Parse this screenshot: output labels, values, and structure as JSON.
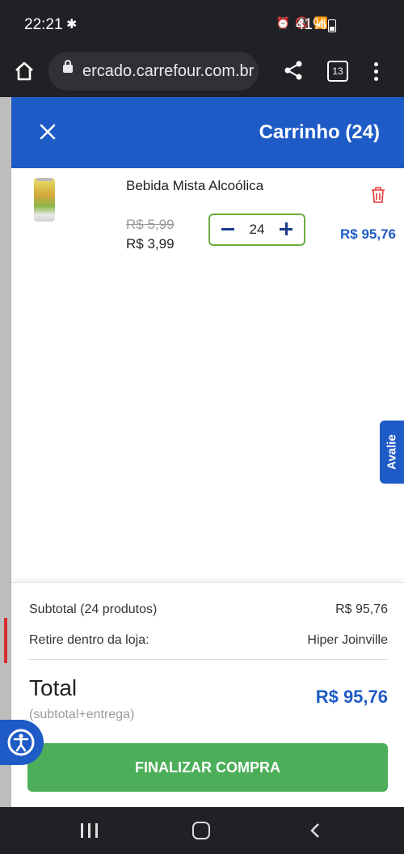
{
  "status_bar": {
    "time": "22:21",
    "battery": "41%",
    "network": "Vo) LTE1 4G"
  },
  "browser": {
    "url": "ercado.carrefour.com.br",
    "tab_count": "13"
  },
  "cart": {
    "title": "Carrinho (24)",
    "item": {
      "name": "Bebida Mista Alcoólica",
      "old_price": "R$ 5,99",
      "price": "R$ 3,99",
      "quantity": "24",
      "line_total": "R$ 95,76"
    }
  },
  "feedback_tab": {
    "label": "Avalie"
  },
  "summary": {
    "subtotal_label": "Subtotal (24 produtos)",
    "subtotal_value": "R$ 95,76",
    "pickup_label": "Retire dentro da loja:",
    "pickup_value": "Hiper Joinville",
    "total_label": "Total",
    "total_sub": "(subtotal+entrega)",
    "total_value": "R$ 95,76",
    "checkout_label": "FINALIZAR COMPRA"
  },
  "colors": {
    "brand_blue": "#1e5bc6",
    "checkout_green": "#4cae58",
    "stepper_border": "#6cae3e",
    "trash_red": "#e53935"
  }
}
